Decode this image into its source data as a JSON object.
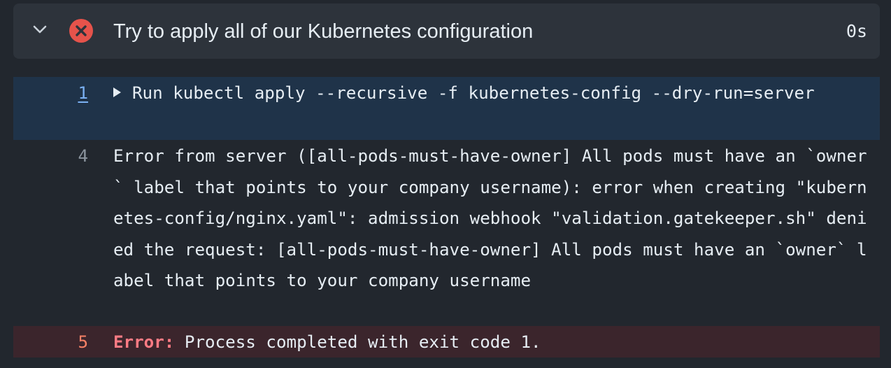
{
  "step": {
    "title": "Try to apply all of our Kubernetes configuration",
    "duration": "0s",
    "status": "failed",
    "icons": {
      "toggle": "chevron-down-icon",
      "status": "x-circle-icon"
    },
    "colors": {
      "error": "#e5534b",
      "header_bg": "#2d333b"
    }
  },
  "log": {
    "lines": [
      {
        "number": "1",
        "text": "Run kubectl apply --recursive -f kubernetes-config --dry-run=server",
        "kind": "group"
      },
      {
        "number": "4",
        "text": "Error from server ([all-pods-must-have-owner] All pods must have an `owner` label that points to your company username): error when creating \"kubernetes-config/nginx.yaml\": admission webhook \"validation.gatekeeper.sh\" denied the request: [all-pods-must-have-owner] All pods must have an `owner` label that points to your company username",
        "kind": "output"
      },
      {
        "number": "5",
        "label": "Error:",
        "text": " Process completed with exit code 1.",
        "kind": "error"
      }
    ],
    "colors": {
      "group_bg": "#1f3349",
      "error_bg": "#3b252c",
      "error_text": "#ff7b84"
    }
  }
}
